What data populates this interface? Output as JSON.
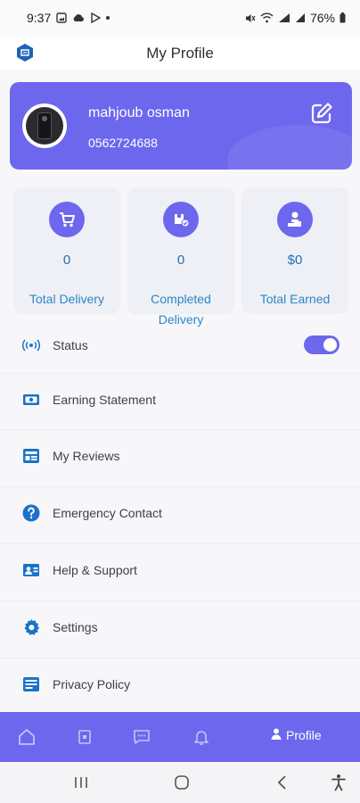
{
  "status_bar": {
    "time": "9:37",
    "battery": "76%"
  },
  "header": {
    "title": "My Profile"
  },
  "profile": {
    "name": "mahjoub osman",
    "phone": "0562724688"
  },
  "stats": [
    {
      "value": "0",
      "label": "Total Delivery",
      "icon": "cart-icon"
    },
    {
      "value": "0",
      "label_line1": "Completed",
      "label_line2": "Delivery",
      "icon": "box-check-icon"
    },
    {
      "value": "$0",
      "label": "Total Earned",
      "icon": "money-hand-icon"
    }
  ],
  "menu": {
    "items": [
      {
        "label": "Status",
        "icon": "broadcast-icon",
        "toggle_on": true
      },
      {
        "label": "Earning Statement",
        "icon": "cash-icon"
      },
      {
        "label": "My Reviews",
        "icon": "reviews-icon"
      },
      {
        "label": "Emergency Contact",
        "icon": "help-circle-icon"
      },
      {
        "label": "Help & Support",
        "icon": "contact-card-icon"
      },
      {
        "label": "Settings",
        "icon": "gear-icon"
      },
      {
        "label": "Privacy Policy",
        "icon": "policy-icon"
      }
    ]
  },
  "bottom_nav": {
    "active_label": "Profile",
    "items": [
      "home-icon",
      "orders-icon",
      "chat-icon",
      "bell-icon",
      "profile-icon"
    ]
  },
  "colors": {
    "accent": "#6d67ee",
    "stat_text": "#2c86c6",
    "menu_icon": "#1a73c9"
  }
}
